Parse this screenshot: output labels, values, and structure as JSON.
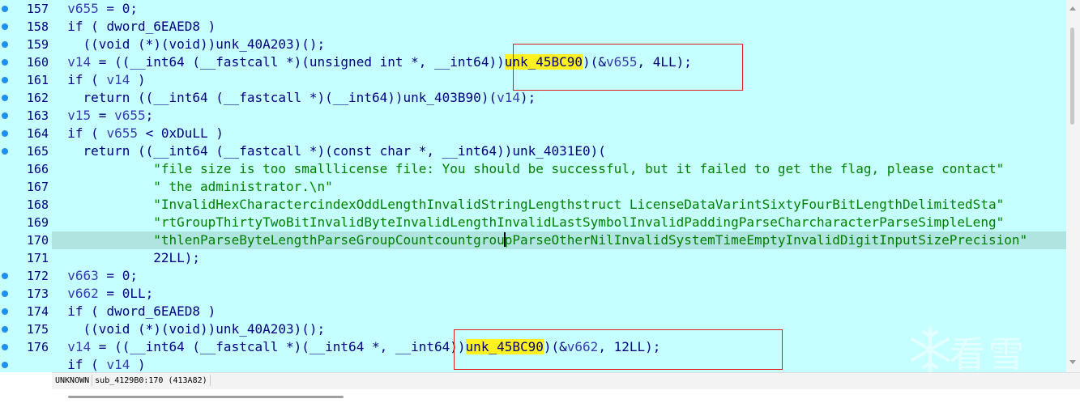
{
  "gutter": {
    "lines": [
      {
        "num": "157",
        "bp": true
      },
      {
        "num": "158",
        "bp": true
      },
      {
        "num": "159",
        "bp": true
      },
      {
        "num": "160",
        "bp": true
      },
      {
        "num": "161",
        "bp": true
      },
      {
        "num": "162",
        "bp": true
      },
      {
        "num": "163",
        "bp": true
      },
      {
        "num": "164",
        "bp": true
      },
      {
        "num": "165",
        "bp": true
      },
      {
        "num": "166",
        "bp": false
      },
      {
        "num": "167",
        "bp": false
      },
      {
        "num": "168",
        "bp": false
      },
      {
        "num": "169",
        "bp": false
      },
      {
        "num": "170",
        "bp": false
      },
      {
        "num": "171",
        "bp": false
      },
      {
        "num": "172",
        "bp": true
      },
      {
        "num": "173",
        "bp": true
      },
      {
        "num": "174",
        "bp": true
      },
      {
        "num": "175",
        "bp": true
      },
      {
        "num": "176",
        "bp": true
      },
      {
        "num": "",
        "bp": true
      }
    ]
  },
  "code": {
    "current_line_index": 13,
    "lines": [
      [
        [
          "  ",
          "op"
        ],
        [
          "v655",
          "var"
        ],
        [
          " = 0;",
          "op"
        ]
      ],
      [
        [
          "  if ( ",
          "kw"
        ],
        [
          "dword_6EAED8",
          "fn"
        ],
        [
          " )",
          "op"
        ]
      ],
      [
        [
          "    ((void (*)(void))",
          "op"
        ],
        [
          "unk_40A203",
          "fn"
        ],
        [
          ")();",
          "op"
        ]
      ],
      [
        [
          "  ",
          "op"
        ],
        [
          "v14",
          "var"
        ],
        [
          " = ((__int64 (__fastcall *)(unsigned int *, __int64))",
          "op"
        ],
        [
          "unk_45BC90",
          "fnhl"
        ],
        [
          ")(&",
          "op"
        ],
        [
          "v655",
          "var"
        ],
        [
          ", 4LL);",
          "op"
        ]
      ],
      [
        [
          "  if ( ",
          "kw"
        ],
        [
          "v14",
          "var"
        ],
        [
          " )",
          "op"
        ]
      ],
      [
        [
          "    return ((__int64 (__fastcall *)(__int64))",
          "op"
        ],
        [
          "unk_403B90",
          "fn"
        ],
        [
          ")(",
          "op"
        ],
        [
          "v14",
          "var"
        ],
        [
          ");",
          "op"
        ]
      ],
      [
        [
          "  ",
          "op"
        ],
        [
          "v15",
          "var"
        ],
        [
          " = ",
          "op"
        ],
        [
          "v655",
          "var"
        ],
        [
          ";",
          "op"
        ]
      ],
      [
        [
          "  if ( ",
          "kw"
        ],
        [
          "v655",
          "var"
        ],
        [
          " < 0xDuLL )",
          "op"
        ]
      ],
      [
        [
          "    return ((__int64 (__fastcall *)(const char *, __int64))",
          "op"
        ],
        [
          "unk_4031E0",
          "fn"
        ],
        [
          ")(",
          "op"
        ]
      ],
      [
        [
          "             ",
          "op"
        ],
        [
          "\"file size is too smalllicense file: You should be successful, but it failed to get the flag, please contact\"",
          "str"
        ]
      ],
      [
        [
          "             ",
          "op"
        ],
        [
          "\" the administrator.\\n\"",
          "str"
        ]
      ],
      [
        [
          "             ",
          "op"
        ],
        [
          "\"InvalidHexCharactercindexOddLengthInvalidStringLengthstruct LicenseDataVarintSixtyFourBitLengthDelimitedSta\"",
          "str"
        ]
      ],
      [
        [
          "             ",
          "op"
        ],
        [
          "\"rtGroupThirtyTwoBitInvalidByteInvalidLengthInvalidLastSymbolInvalidPaddingParseCharcharacterParseSimpleLeng\"",
          "str"
        ]
      ],
      [
        [
          "             ",
          "op"
        ],
        [
          "\"thlenParseByteLengthParseGroupCountcountgrou",
          "str"
        ],
        [
          "|CURSOR|",
          "cursor"
        ],
        [
          "pParseOtherNilInvalidSystemTimeEmptyInvalidDigitInputSizePrecision\"",
          "str"
        ]
      ],
      [
        [
          "             22LL);",
          "op"
        ]
      ],
      [
        [
          "  ",
          "op"
        ],
        [
          "v663",
          "var"
        ],
        [
          " = 0;",
          "op"
        ]
      ],
      [
        [
          "  ",
          "op"
        ],
        [
          "v662",
          "var"
        ],
        [
          " = 0LL;",
          "op"
        ]
      ],
      [
        [
          "  if ( ",
          "kw"
        ],
        [
          "dword_6EAED8",
          "fn"
        ],
        [
          " )",
          "op"
        ]
      ],
      [
        [
          "    ((void (*)(void))",
          "op"
        ],
        [
          "unk_40A203",
          "fn"
        ],
        [
          ")();",
          "op"
        ]
      ],
      [
        [
          "  ",
          "op"
        ],
        [
          "v14",
          "var"
        ],
        [
          " = ((__int64 (__fastcall *)(__int64 *, __int64))",
          "op"
        ],
        [
          "unk_45BC90",
          "fnhl"
        ],
        [
          ")(&",
          "op"
        ],
        [
          "v662",
          "var"
        ],
        [
          ", 12LL);",
          "op"
        ]
      ],
      [
        [
          "  if ( ",
          "kw"
        ],
        [
          "v14",
          "var"
        ],
        [
          " )",
          "op"
        ]
      ]
    ]
  },
  "status": {
    "mode": "UNKNOWN",
    "location": "sub_4129B0:170 (413A82)"
  },
  "watermark": {
    "text": "看雪"
  },
  "colors": {
    "background": "#c5ffff",
    "highlight": "#fff11f",
    "annotation": "#e02020",
    "breakpoint": "#1f8fef"
  }
}
